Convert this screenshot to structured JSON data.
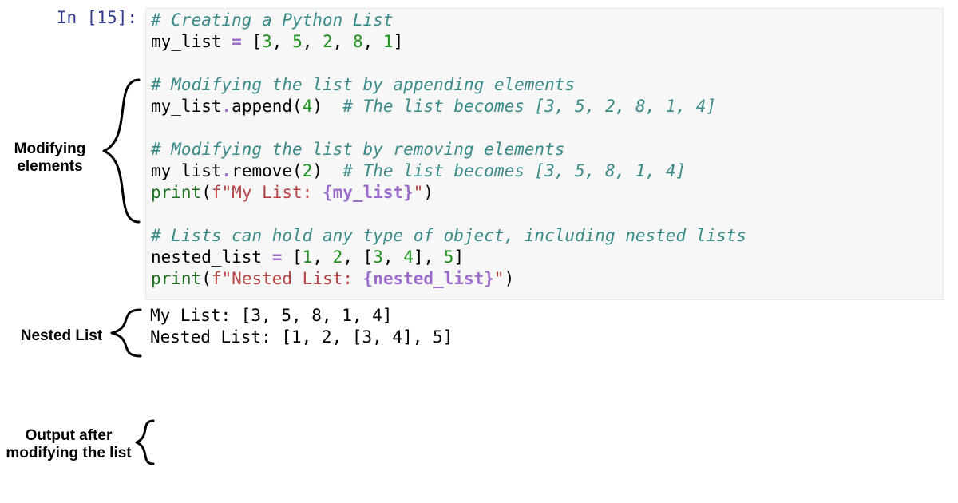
{
  "prompt": "In [15]:",
  "prompt_in": "In [",
  "prompt_num": "15",
  "prompt_close": "]:",
  "code": {
    "l1_comment": "# Creating a Python List",
    "l2_a": "my_list",
    "l2_eq": " = ",
    "l2_open": "[",
    "l2_n1": "3",
    "l2_n2": "5",
    "l2_n3": "2",
    "l2_n4": "8",
    "l2_n5": "1",
    "l2_close": "]",
    "sep": ", ",
    "l4_comment": "# Modifying the list by appending elements",
    "l5_a": "my_list",
    "l5_dot": ".",
    "l5_fn": "append",
    "l5_open": "(",
    "l5_n": "4",
    "l5_close": ")",
    "l5_tail": "  ",
    "l5_cmt": "# The list becomes [3, 5, 2, 8, 1, 4]",
    "l7_comment": "# Modifying the list by removing elements",
    "l8_a": "my_list",
    "l8_fn": "remove",
    "l8_open": "(",
    "l8_n": "2",
    "l8_close": ")",
    "l8_tail": "  ",
    "l8_cmt": "# The list becomes [3, 5, 8, 1, 4]",
    "l9_print": "print",
    "l9_open": "(",
    "l9_f": "f\"",
    "l9_str": "My List: ",
    "l9_exp": "{my_list}",
    "l9_qclose": "\"",
    "l9_close": ")",
    "l11_comment": "# Lists can hold any type of object, including nested lists",
    "l12_a": "nested_list",
    "l12_eq": " = ",
    "l12_open": "[",
    "l12_n1": "1",
    "l12_n2": "2",
    "l12_open2": "[",
    "l12_n3": "3",
    "l12_n4": "4",
    "l12_close2": "]",
    "l12_n5": "5",
    "l12_close": "]",
    "l13_print": "print",
    "l13_open": "(",
    "l13_f": "f\"",
    "l13_str": "Nested List: ",
    "l13_exp": "{nested_list}",
    "l13_qclose": "\"",
    "l13_close": ")"
  },
  "output": {
    "line1": "My List: [3, 5, 8, 1, 4]",
    "line2": "Nested List: [1, 2, [3, 4], 5]"
  },
  "annotations": {
    "modifying_l1": "Modifying",
    "modifying_l2": "elements",
    "nested": "Nested List",
    "output_l1": "Output after",
    "output_l2": "modifying the list"
  }
}
